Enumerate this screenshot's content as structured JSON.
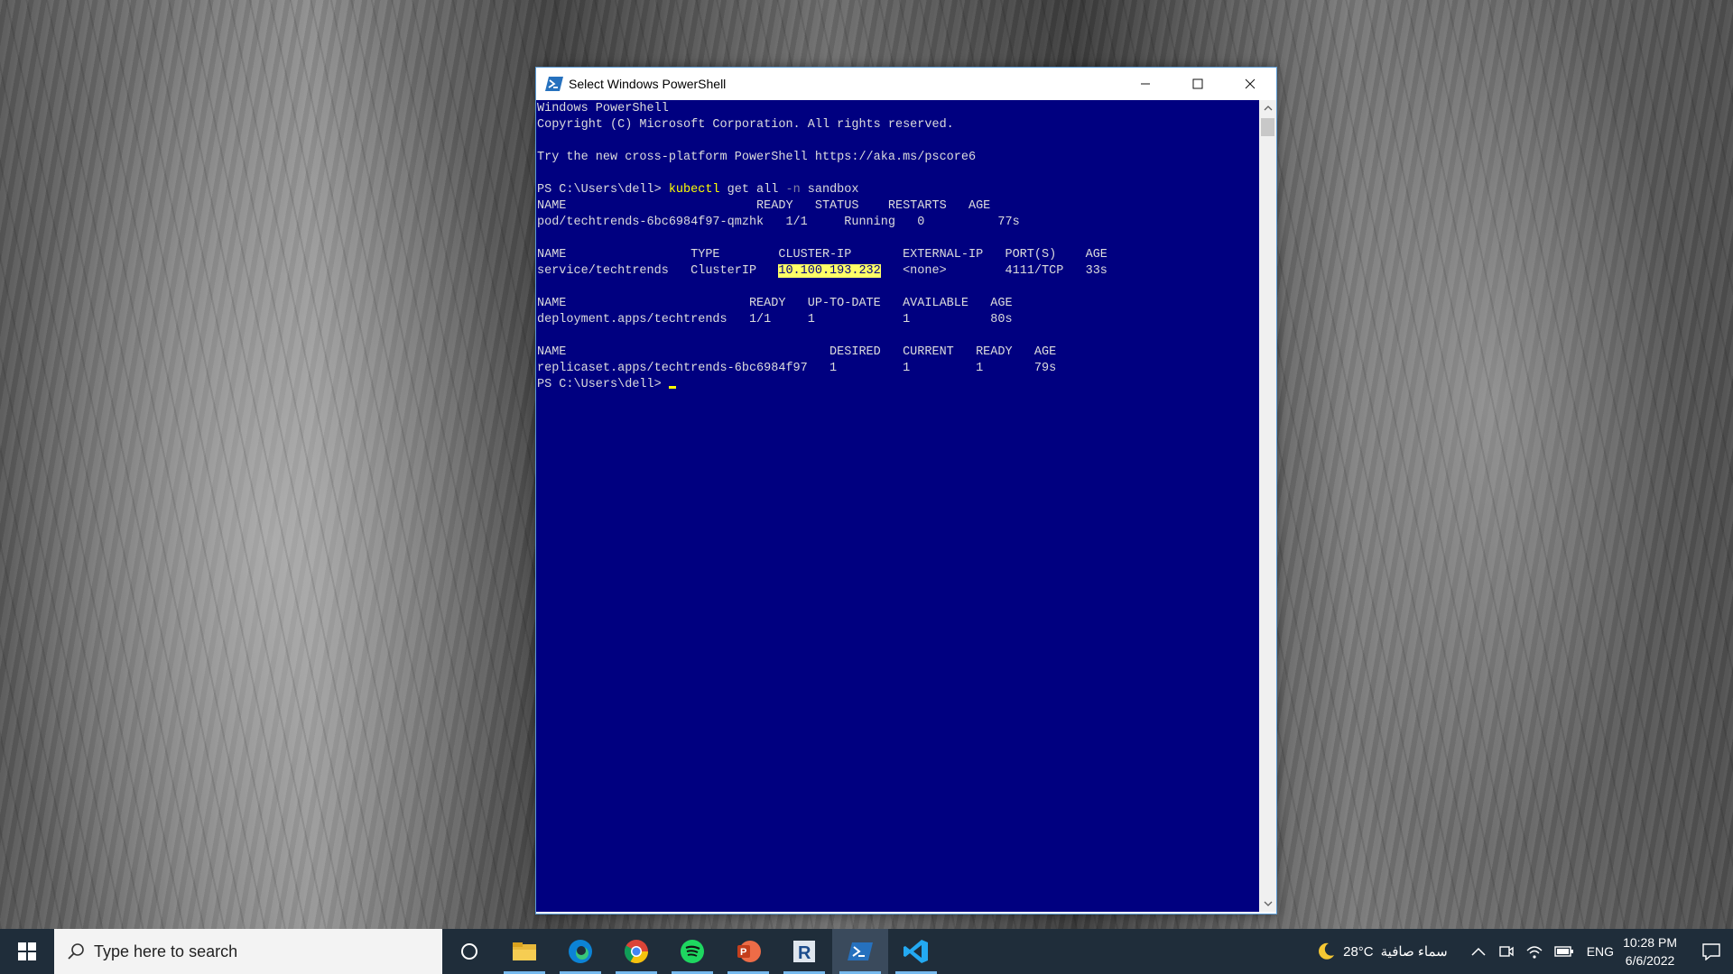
{
  "window": {
    "title": "Select Windows PowerShell",
    "controls": {
      "minimize": "—",
      "maximize": "☐",
      "close": "✕"
    }
  },
  "console": {
    "header_line1": "Windows PowerShell",
    "header_line2": "Copyright (C) Microsoft Corporation. All rights reserved.",
    "header_line3": "Try the new cross-platform PowerShell https://aka.ms/pscore6",
    "prompt": "PS C:\\Users\\dell> ",
    "command_name": "kubectl",
    "command_args": " get all ",
    "command_flag": "-n",
    "command_value": " sandbox",
    "pod_header": "NAME                          READY   STATUS    RESTARTS   AGE",
    "pod_row": "pod/techtrends-6bc6984f97-qmzhk   1/1     Running   0          77s",
    "svc_header": "NAME                 TYPE        CLUSTER-IP       EXTERNAL-IP   PORT(S)    AGE",
    "svc_row_pre": "service/techtrends   ClusterIP   ",
    "svc_cluster_ip": "10.100.193.232",
    "svc_row_post": "   <none>        4111/TCP   33s",
    "deploy_header": "NAME                         READY   UP-TO-DATE   AVAILABLE   AGE",
    "deploy_row": "deployment.apps/techtrends   1/1     1            1           80s",
    "rs_header": "NAME                                    DESIRED   CURRENT   READY   AGE",
    "rs_row": "replicaset.apps/techtrends-6bc6984f97   1         1         1       79s",
    "final_prompt": "PS C:\\Users\\dell> "
  },
  "taskbar": {
    "search_placeholder": "Type here to search",
    "apps": [
      "task-view",
      "file-explorer",
      "edge",
      "chrome",
      "spotify",
      "powerpoint",
      "r-app",
      "powershell",
      "vscode"
    ],
    "weather_temp": "28°C",
    "weather_text": "سماء صافية",
    "language": "ENG",
    "time": "10:28 PM",
    "date": "6/6/2022"
  }
}
